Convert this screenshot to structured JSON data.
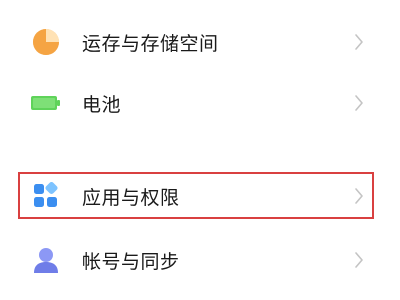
{
  "settings": {
    "items": [
      {
        "label": "运存与存储空间",
        "icon": "storage-pie-icon",
        "icon_color": "#f5a443"
      },
      {
        "label": "电池",
        "icon": "battery-icon",
        "icon_color": "#5fd35a"
      },
      {
        "label": "应用与权限",
        "icon": "apps-grid-icon",
        "icon_color": "#3b8ef0",
        "highlighted": true
      },
      {
        "label": "帐号与同步",
        "icon": "person-icon",
        "icon_color": "#7f8cf0"
      }
    ]
  },
  "colors": {
    "highlight_border": "#d94040",
    "chevron": "#c4c4c4"
  }
}
